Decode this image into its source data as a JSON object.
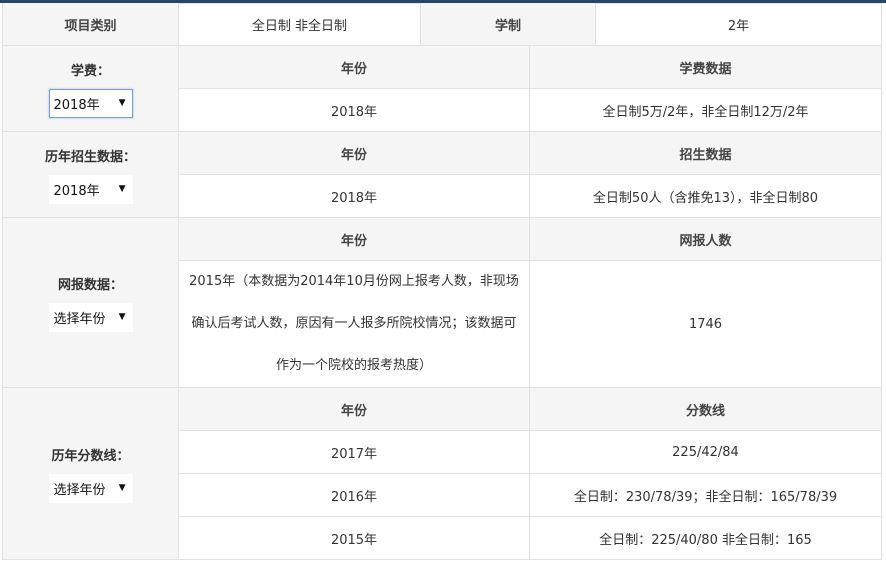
{
  "header": {
    "category_label": "项目类别",
    "category_value": "全日制 非全日制",
    "system_label": "学制",
    "system_value": "2年"
  },
  "tuition": {
    "label": "学费：",
    "select_value": "2018年",
    "col_year": "年份",
    "col_data": "学费数据",
    "row": {
      "year": "2018年",
      "value": "全日制5万/2年，非全日制12万/2年"
    }
  },
  "enrollment": {
    "label": "历年招生数据：",
    "select_value": "2018年",
    "col_year": "年份",
    "col_data": "招生数据",
    "row": {
      "year": "2018年",
      "value": "全日制50人（含推免13），非全日制80"
    }
  },
  "online_registration": {
    "label": "网报数据：",
    "select_value": "选择年份",
    "col_year": "年份",
    "col_data": "网报人数",
    "row": {
      "year_lines": [
        "2015年（本数据为2014年10月份网上报考人数，非现场",
        "确认后考试人数，原因有一人报多所院校情况；该数据可",
        "作为一个院校的报考热度）"
      ],
      "value": "1746"
    }
  },
  "score_lines": {
    "label": "历年分数线：",
    "select_value": "选择年份",
    "col_year": "年份",
    "col_data": "分数线",
    "rows": [
      {
        "year": "2017年",
        "value": "225/42/84"
      },
      {
        "year": "2016年",
        "value": "全日制：230/78/39；非全日制：165/78/39"
      },
      {
        "year": "2015年",
        "value": "全日制：225/40/80 非全日制：165"
      }
    ]
  }
}
